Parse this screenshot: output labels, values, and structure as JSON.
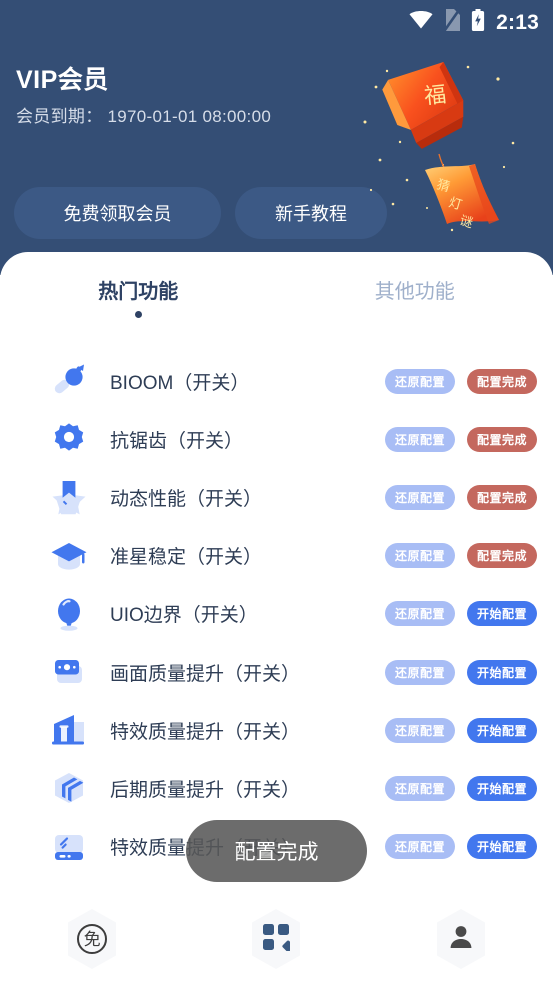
{
  "status_bar": {
    "time": "2:13",
    "icons": [
      "wifi-icon",
      "sim-off-icon",
      "battery-charging-icon"
    ]
  },
  "header": {
    "title": "VIP会员",
    "expiry_label": "会员到期：",
    "expiry_value": "1970-01-01 08:00:00",
    "expiry_full": "会员到期： 1970-01-01 08:00:00",
    "buttons": [
      {
        "label": "免费领取会员",
        "name": "claim-free-vip-button"
      },
      {
        "label": "新手教程",
        "name": "beginner-tutorial-button"
      }
    ],
    "illustration": {
      "name": "sky-lantern-illustration",
      "lantern_char": "福",
      "banner_char": "猜灯谜"
    },
    "bg_color": "#344e75",
    "button_color": "#3c5985"
  },
  "tabs": [
    {
      "label": "热门功能",
      "active": true
    },
    {
      "label": "其他功能",
      "active": false
    }
  ],
  "pill_labels": {
    "restore": "还原配置",
    "done": "配置完成",
    "start": "开始配置"
  },
  "pill_colors": {
    "restore": "#a8bdf5",
    "done": "#c4685e",
    "start": "#4277ee"
  },
  "rows": [
    {
      "icon": "bomb-icon",
      "label": "BIOOM（开关）",
      "action": "done"
    },
    {
      "icon": "gear-icon",
      "label": "抗锯齿（开关）",
      "action": "done"
    },
    {
      "icon": "star-badge-icon",
      "label": "动态性能（开关）",
      "action": "done"
    },
    {
      "icon": "graduation-cap-icon",
      "label": "准星稳定（开关）",
      "action": "done"
    },
    {
      "icon": "balloon-icon",
      "label": "UIO边界（开关）",
      "action": "start"
    },
    {
      "icon": "film-frame-icon",
      "label": "画面质量提升（开关）",
      "action": "start"
    },
    {
      "icon": "building-icon",
      "label": "特效质量提升（开关）",
      "action": "start"
    },
    {
      "icon": "layers-cube-icon",
      "label": "后期质量提升（开关）",
      "action": "start"
    },
    {
      "icon": "harddrive-icon",
      "label": "特效质量提升（开关）",
      "action": "start"
    }
  ],
  "toast": {
    "message": "配置完成"
  },
  "bottom_nav": [
    {
      "name": "nav-free-button",
      "icon": "free-badge-icon",
      "glyph": "免"
    },
    {
      "name": "nav-grid-button",
      "icon": "grid-apps-icon",
      "glyph": ""
    },
    {
      "name": "nav-profile-button",
      "icon": "person-icon",
      "glyph": ""
    }
  ]
}
